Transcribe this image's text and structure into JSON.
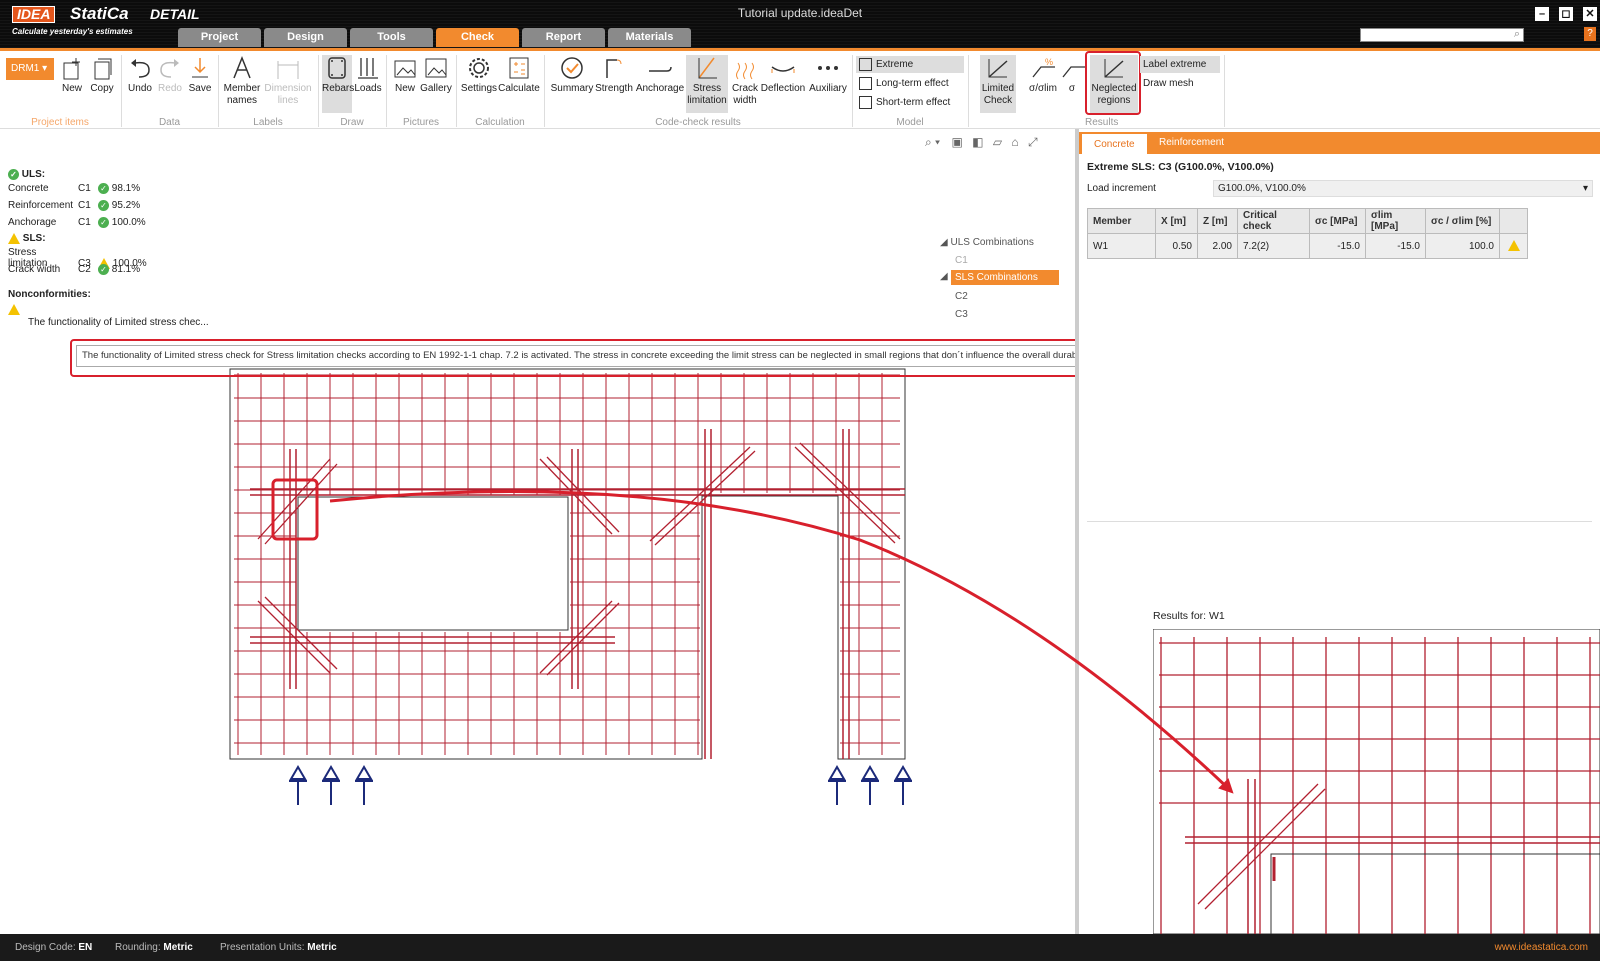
{
  "app": {
    "logo_box": "IDEA",
    "logo_text": "StatiCa",
    "logo_product": "DETAIL",
    "tagline": "Calculate yesterday's estimates",
    "window_title": "Tutorial update.ideaDet",
    "min": "–",
    "max": "◻",
    "close": "✕",
    "help": "?"
  },
  "tabs": [
    {
      "label": "Project"
    },
    {
      "label": "Design"
    },
    {
      "label": "Tools"
    },
    {
      "label": "Check",
      "active": true
    },
    {
      "label": "Report"
    },
    {
      "label": "Materials"
    }
  ],
  "search": {
    "icon": "⌕"
  },
  "ribbon": {
    "drm": "DRM1",
    "new": "New",
    "copy": "Copy",
    "undo": "Undo",
    "redo": "Redo",
    "save": "Save",
    "member_names_1": "Member",
    "member_names_2": "names",
    "dimension_lines_1": "Dimension",
    "dimension_lines_2": "lines",
    "rebars": "Rebars",
    "loads": "Loads",
    "pic_new": "New",
    "gallery": "Gallery",
    "settings": "Settings",
    "calculate": "Calculate",
    "summary": "Summary",
    "strength": "Strength",
    "anchorage": "Anchorage",
    "stress_limitation_1": "Stress",
    "stress_limitation_2": "limitation",
    "crack_width_1": "Crack",
    "crack_width_2": "width",
    "deflection": "Deflection",
    "auxiliary": "Auxiliary",
    "extreme": "Extreme",
    "long_term": "Long-term effect",
    "short_term": "Short-term effect",
    "limited_check_1": "Limited",
    "limited_check_2": "Check",
    "sigma_lim": "σ/σlim",
    "sigma": "σ",
    "neglected_1": "Neglected",
    "neglected_2": "regions",
    "label_extreme": "Label extreme",
    "draw_mesh": "Draw mesh",
    "groups": {
      "project_items": "Project items",
      "data": "Data",
      "labels": "Labels",
      "draw": "Draw",
      "pictures": "Pictures",
      "calculation": "Calculation",
      "code_check": "Code-check results",
      "model": "Model",
      "results": "Results"
    }
  },
  "summary": {
    "uls_title": "ULS:",
    "sls_title": "SLS:",
    "rows_uls": [
      {
        "name": "Concrete",
        "comb": "C1",
        "value": "98.1%"
      },
      {
        "name": "Reinforcement",
        "comb": "C1",
        "value": "95.2%"
      },
      {
        "name": "Anchorage",
        "comb": "C1",
        "value": "100.0%"
      }
    ],
    "rows_sls": [
      {
        "name": "Stress limitation",
        "comb": "C3",
        "value": "100.0%"
      },
      {
        "name": "Crack width",
        "comb": "C2",
        "value": "81.1%"
      }
    ],
    "nonconf_title": "Nonconformities:",
    "nonconf_item": "The functionality of Limited stress chec..."
  },
  "tooltip": "The functionality of Limited stress check for Stress limitation checks according to EN 1992-1-1 chap. 7.2 is activated. The stress in concrete exceeding the limit stress can be neglected in small regions that don´t influence the overall durability of the structure.",
  "tree": {
    "uls": "ULS Combinations",
    "c1": "C1",
    "sls": "SLS Combinations",
    "c2": "C2",
    "c3": "C3"
  },
  "right": {
    "tab_concrete": "Concrete",
    "tab_reinforcement": "Reinforcement",
    "heading": "Extreme SLS: C3 (G100.0%, V100.0%)",
    "load_increment_label": "Load increment",
    "load_increment_value": "G100.0%, V100.0%",
    "table_headers": [
      "Member",
      "X [m]",
      "Z [m]",
      "Critical check",
      "σc [MPa]",
      "σlim [MPa]",
      "σc / σlim [%]",
      ""
    ],
    "table_row": [
      "W1",
      "0.50",
      "2.00",
      "7.2(2)",
      "-15.0",
      "-15.0",
      "100.0"
    ],
    "results_for": "Results for: W1"
  },
  "status": {
    "design_code_label": "Design Code:",
    "design_code": "EN",
    "rounding_label": "Rounding:",
    "rounding": "Metric",
    "units_label": "Presentation Units:",
    "units": "Metric",
    "website": "www.ideastatica.com"
  }
}
